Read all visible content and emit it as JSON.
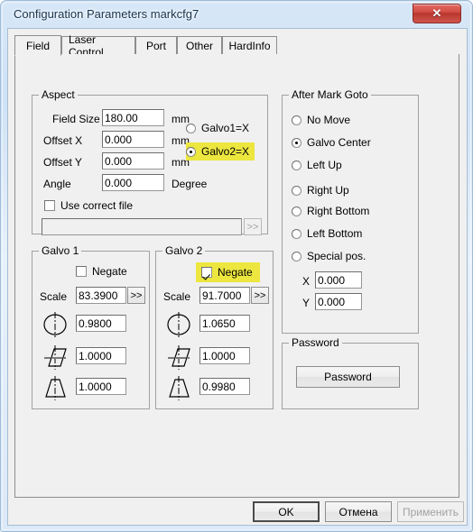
{
  "window": {
    "title": "Configuration Parameters markcfg7",
    "close_label": "✕",
    "close_icon": "close-icon"
  },
  "tabs": [
    {
      "label": "Field",
      "active": true
    },
    {
      "label": "Laser Control",
      "active": false
    },
    {
      "label": "Port",
      "active": false
    },
    {
      "label": "Other",
      "active": false
    },
    {
      "label": "HardInfo",
      "active": false
    }
  ],
  "colors": {
    "highlight": "#ece63f",
    "dialog_face": "#f0f0f0",
    "frame_blue": "#cfe2f5",
    "close_red": "#c94338"
  },
  "aspect": {
    "title": "Aspect",
    "field_size_label": "Field Size",
    "field_size_value": "180.00",
    "field_size_unit": "mm",
    "offset_x_label": "Offset X",
    "offset_x_value": "0.000",
    "offset_x_unit": "mm",
    "offset_y_label": "Offset Y",
    "offset_y_value": "0.000",
    "offset_y_unit": "mm",
    "angle_label": "Angle",
    "angle_value": "0.000",
    "angle_unit": "Degree",
    "galvo_axis_options": [
      {
        "label": "Galvo1=X",
        "checked": false,
        "highlighted": false
      },
      {
        "label": "Galvo2=X",
        "checked": true,
        "highlighted": true
      }
    ],
    "use_correct_file_label": "Use correct file",
    "use_correct_file_checked": false,
    "correct_file_value": "",
    "correct_file_placeholder": "",
    "browse_label": ">>"
  },
  "after_mark_goto": {
    "title": "After Mark Goto",
    "options": [
      {
        "label": "No Move",
        "checked": false
      },
      {
        "label": "Galvo Center",
        "checked": true
      },
      {
        "label": "Left Up",
        "checked": false
      },
      {
        "label": "Right Up",
        "checked": false
      },
      {
        "label": "Right Bottom",
        "checked": false
      },
      {
        "label": "Left Bottom",
        "checked": false
      },
      {
        "label": "Special pos.",
        "checked": false
      }
    ],
    "x_label": "X",
    "x_value": "0.000",
    "y_label": "Y",
    "y_value": "0.000"
  },
  "galvo1": {
    "title": "Galvo 1",
    "negate_label": "Negate",
    "negate_checked": false,
    "negate_highlighted": false,
    "scale_label": "Scale",
    "scale_value": "83.3900",
    "scale_browse_label": ">>",
    "corrections": [
      {
        "icon": "ellipse-correction-icon",
        "value": "0.9800"
      },
      {
        "icon": "parallelogram-correction-icon",
        "value": "1.0000"
      },
      {
        "icon": "trapezoid-correction-icon",
        "value": "1.0000"
      }
    ]
  },
  "galvo2": {
    "title": "Galvo 2",
    "negate_label": "Negate",
    "negate_checked": true,
    "negate_highlighted": true,
    "scale_label": "Scale",
    "scale_value": "91.7000",
    "scale_browse_label": ">>",
    "corrections": [
      {
        "icon": "ellipse-correction-icon",
        "value": "1.0650"
      },
      {
        "icon": "parallelogram-correction-icon",
        "value": "1.0000"
      },
      {
        "icon": "trapezoid-correction-icon",
        "value": "0.9980"
      }
    ]
  },
  "password": {
    "title": "Password",
    "button_label": "Password"
  },
  "footer": {
    "ok_label": "OK",
    "cancel_label": "Отмена",
    "apply_label": "Применить",
    "apply_enabled": false
  }
}
